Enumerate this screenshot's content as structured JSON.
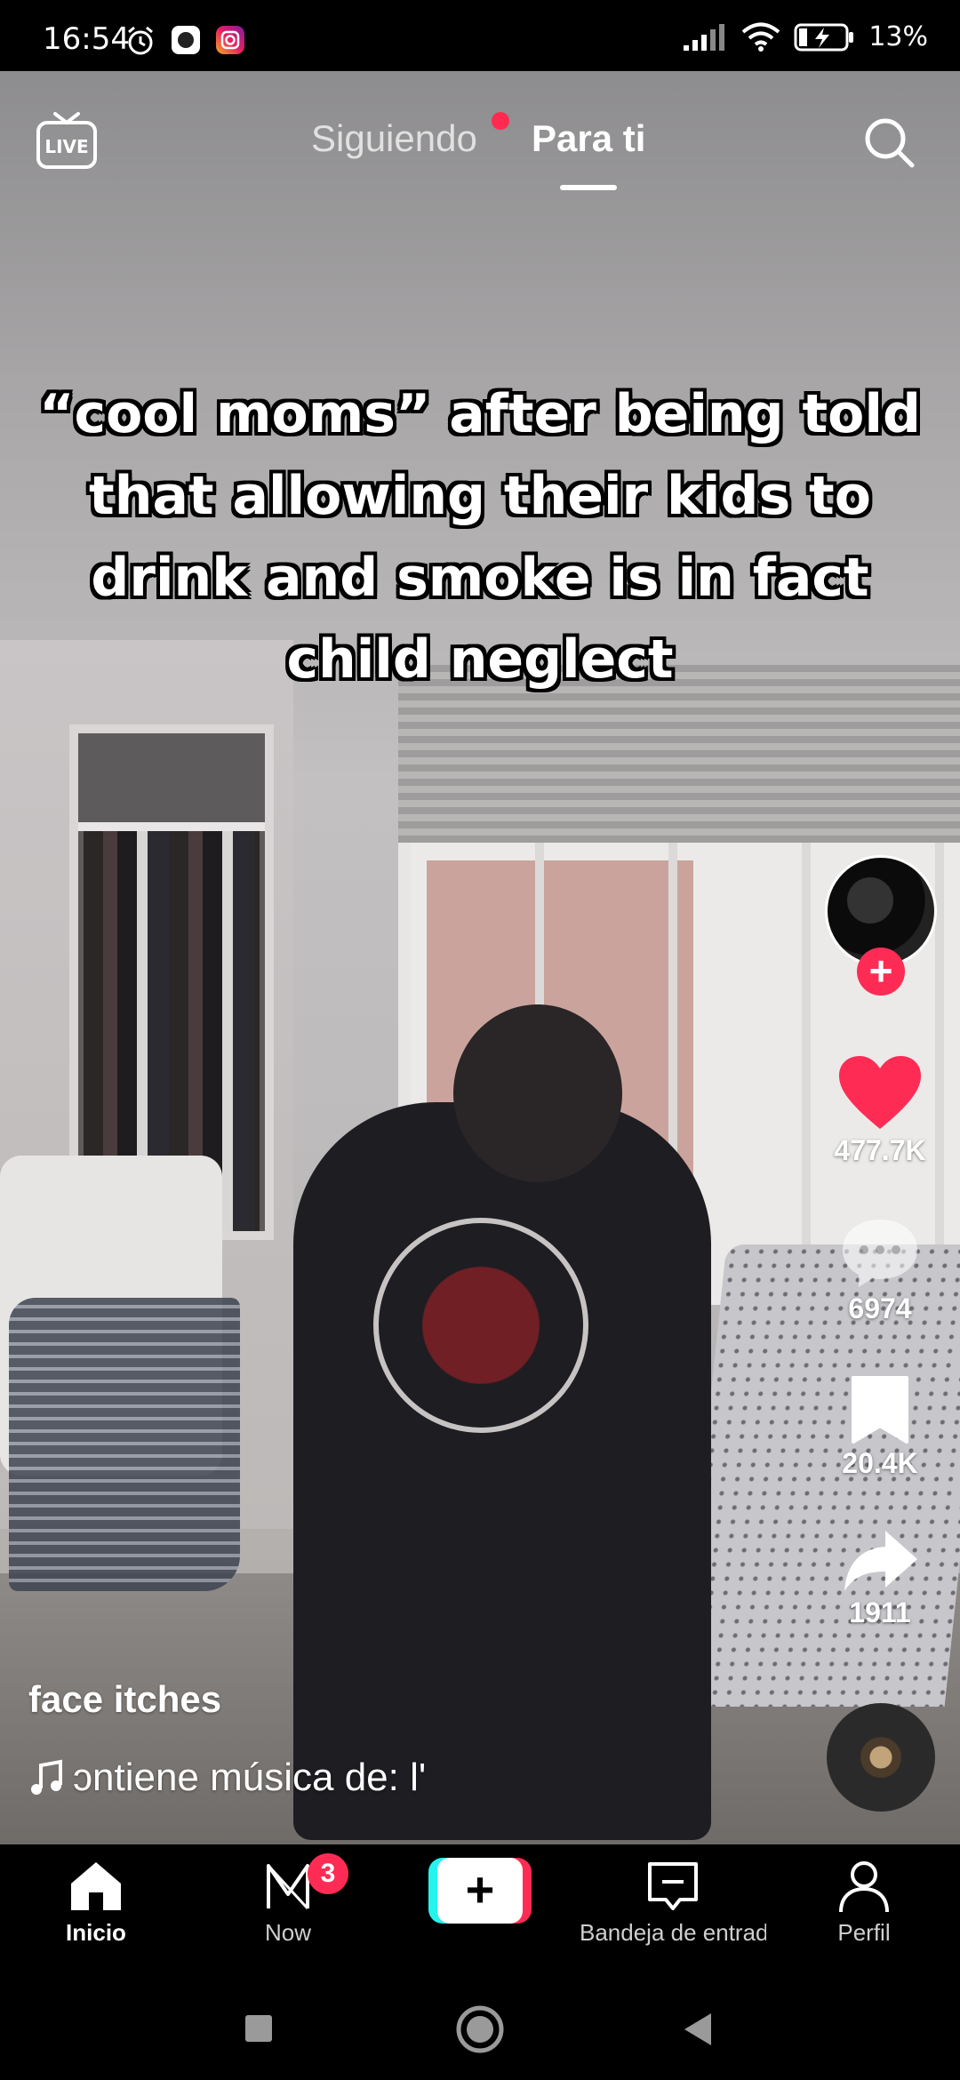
{
  "status_bar": {
    "time": "16:54",
    "battery": "13%"
  },
  "top_nav": {
    "live_label": "LIVE",
    "tab_following": "Siguiendo",
    "tab_for_you": "Para ti"
  },
  "video": {
    "caption": "“cool moms” after being told that allowing their kids to drink and smoke is in fact child neglect",
    "username": "face itches",
    "music_text": "ɔntiene música de: l'"
  },
  "actions": {
    "likes": "477.7K",
    "comments": "6974",
    "saves": "20.4K",
    "shares": "1911"
  },
  "bottom_nav": {
    "home": "Inicio",
    "now": "Now",
    "now_badge": "3",
    "create": "+",
    "inbox": "Bandeja de entrada",
    "profile": "Perfil"
  },
  "colors": {
    "accent_red": "#fe2c55",
    "accent_cyan": "#25f4ee"
  },
  "icons": [
    "alarm-icon",
    "app-icon",
    "instagram-icon",
    "signal-icon",
    "wifi-icon",
    "battery-icon",
    "live-tv-icon",
    "search-icon",
    "heart-icon",
    "comment-icon",
    "bookmark-icon",
    "share-icon",
    "music-note-icon",
    "home-icon",
    "now-icon",
    "inbox-icon",
    "profile-icon",
    "square-nav-icon",
    "circle-nav-icon",
    "back-nav-icon"
  ]
}
